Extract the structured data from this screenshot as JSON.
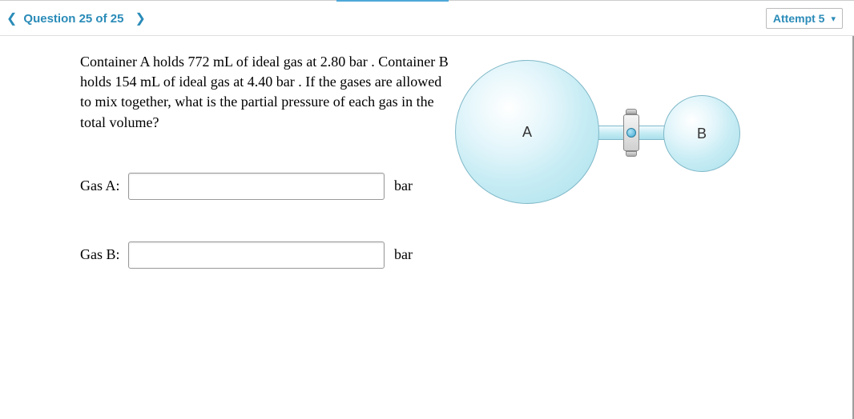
{
  "header": {
    "question_label": "Question 25 of 25",
    "attempt_label": "Attempt 5"
  },
  "problem": {
    "text": "Container A holds 772 mL of ideal gas at 2.80 bar . Container B holds 154 mL of ideal gas at 4.40 bar . If the gases are allowed to mix together, what is the partial pressure of each gas in the total volume?"
  },
  "inputs": {
    "gasA": {
      "label": "Gas A:",
      "value": "",
      "unit": "bar"
    },
    "gasB": {
      "label": "Gas B:",
      "value": "",
      "unit": "bar"
    }
  },
  "diagram": {
    "sphereA_label": "A",
    "sphereB_label": "B"
  }
}
